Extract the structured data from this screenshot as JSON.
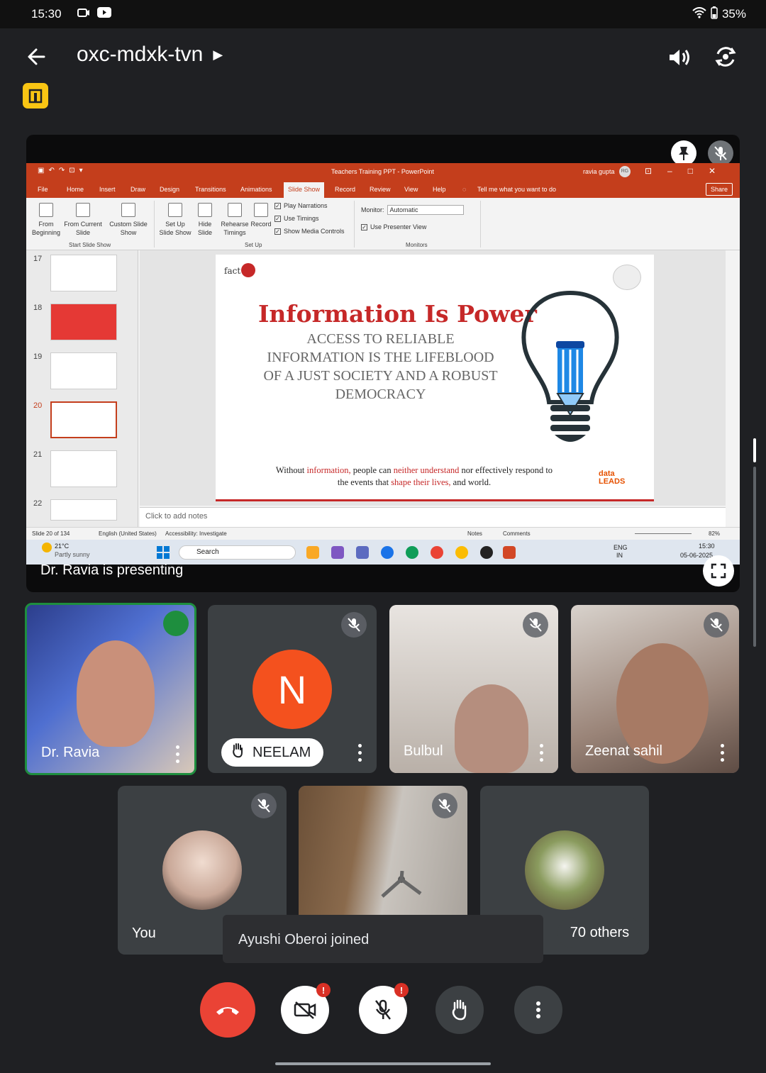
{
  "status": {
    "time": "15:30",
    "battery": "35%"
  },
  "header": {
    "meeting_code": "oxc-mdxk-tvn"
  },
  "presentation": {
    "presenter_caption": "Dr. Ravia is presenting",
    "app": {
      "doc_title": "Teachers Training PPT  -  PowerPoint",
      "user": "ravia gupta",
      "user_initials": "RG",
      "tabs": [
        "File",
        "Home",
        "Insert",
        "Draw",
        "Design",
        "Transitions",
        "Animations",
        "Slide Show",
        "Record",
        "Review",
        "View",
        "Help"
      ],
      "tell_me": "Tell me what you want to do",
      "share_label": "Share",
      "ribbon": {
        "from_beginning": "From Beginning",
        "from_current": "From Current Slide",
        "custom_show": "Custom Slide Show",
        "group_start": "Start Slide Show",
        "set_up": "Set Up Slide Show",
        "hide_slide": "Hide Slide",
        "rehearse": "Rehearse Timings",
        "record": "Record",
        "play_narrations": "Play Narrations",
        "use_timings": "Use Timings",
        "show_media": "Show Media Controls",
        "group_setup": "Set Up",
        "monitor_label": "Monitor:",
        "monitor_value": "Automatic",
        "presenter_view": "Use Presenter View",
        "group_monitors": "Monitors"
      },
      "slide_numbers": [
        "17",
        "18",
        "19",
        "20",
        "21",
        "22"
      ],
      "slide": {
        "heading": "Information Is Power",
        "body": "ACCESS TO RELIABLE INFORMATION IS THE LIFEBLOOD OF A JUST SOCIETY AND A ROBUST DEMOCRACY",
        "foot_1": "Without",
        "foot_2": "information,",
        "foot_3": "people can",
        "foot_4": "neither understand",
        "foot_5": "nor effectively respond to",
        "foot_6": "the events that",
        "foot_7": "shape their lives,",
        "foot_8": "and world.",
        "logo_left": "fact",
        "logo_right": "data LEADS"
      },
      "notes_placeholder": "Click to add notes",
      "statusbar": {
        "slide_count": "Slide 20 of 134",
        "language": "English (United States)",
        "accessibility": "Accessibility: Investigate",
        "notes": "Notes",
        "comments": "Comments",
        "zoom": "82%"
      },
      "taskbar": {
        "weather_temp": "21°C",
        "weather_desc": "Partly sunny",
        "search": "Search",
        "lang_1": "ENG",
        "lang_2": "IN",
        "clock_time": "15:30",
        "clock_date": "05-06-2025"
      }
    }
  },
  "participants": [
    {
      "name": "Dr. Ravia"
    },
    {
      "name": "NEELAM",
      "initial": "N"
    },
    {
      "name": "Bulbul"
    },
    {
      "name": "Zeenat sahil"
    },
    {
      "name": "You"
    },
    {
      "name": ""
    },
    {
      "name": "70 others"
    }
  ],
  "toast": "Ayushi Oberoi joined",
  "colors": {
    "end_call": "#ea4335",
    "avatar_n": "#f4511e",
    "ppt_red": "#c43e1c",
    "alert": "#d93025"
  }
}
